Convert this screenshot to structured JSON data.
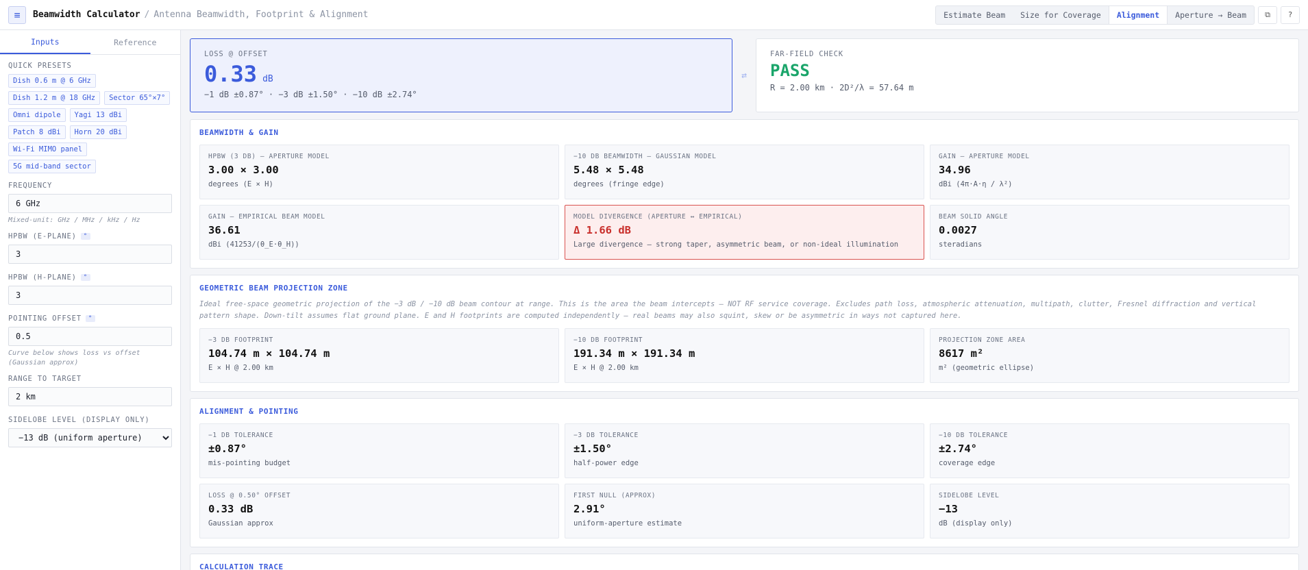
{
  "header": {
    "title": "Beamwidth Calculator",
    "separator": "/",
    "subtitle": "Antenna Beamwidth, Footprint & Alignment",
    "menu_icon": "≡",
    "tabs": [
      "Estimate Beam",
      "Size for Coverage",
      "Alignment",
      "Aperture → Beam"
    ],
    "active_tab": "Alignment",
    "copy_icon": "⧉",
    "help_icon": "?"
  },
  "sidebar": {
    "tabs": [
      "Inputs",
      "Reference"
    ],
    "presets_label": "QUICK PRESETS",
    "presets": [
      "Dish 0.6 m @ 6 GHz",
      "Dish 1.2 m @ 18 GHz",
      "Sector 65°×7°",
      "Omni dipole",
      "Yagi 13 dBi",
      "Patch 8 dBi",
      "Horn 20 dBi",
      "Wi-Fi MIMO panel",
      "5G mid-band sector"
    ],
    "frequency": {
      "label": "FREQUENCY",
      "value": "6 GHz",
      "hint": "Mixed-unit: GHz / MHz / kHz / Hz"
    },
    "hpbw_e": {
      "label": "HPBW (E-PLANE)",
      "badge": "°",
      "value": "3"
    },
    "hpbw_h": {
      "label": "HPBW (H-PLANE)",
      "badge": "°",
      "value": "3"
    },
    "pointing": {
      "label": "POINTING OFFSET",
      "badge": "°",
      "value": "0.5",
      "hint": "Curve below shows loss vs offset (Gaussian approx)"
    },
    "range": {
      "label": "RANGE TO TARGET",
      "value": "2 km"
    },
    "sidelobe": {
      "label": "SIDELOBE LEVEL (DISPLAY ONLY)",
      "value": "−13 dB (uniform aperture)"
    }
  },
  "hero": {
    "loss": {
      "label": "LOSS @ OFFSET",
      "value": "0.33",
      "unit": "dB",
      "sub": "−1 dB ±0.87° · −3 dB ±1.50° · −10 dB ±2.74°"
    },
    "swap_icon": "⇄",
    "farfield": {
      "label": "FAR-FIELD CHECK",
      "value": "PASS",
      "sub": "R = 2.00 km · 2D²/λ = 57.64 m"
    }
  },
  "beamwidth": {
    "title": "BEAMWIDTH & GAIN",
    "cards": [
      {
        "label": "HPBW (3 DB) — APERTURE MODEL",
        "value": "3.00 × 3.00",
        "sub": "degrees (E × H)"
      },
      {
        "label": "−10 DB BEAMWIDTH — GAUSSIAN MODEL",
        "value": "5.48 × 5.48",
        "sub": "degrees (fringe edge)"
      },
      {
        "label": "GAIN — APERTURE MODEL",
        "value": "34.96",
        "sub": "dBi (4π·A·η / λ²)"
      },
      {
        "label": "GAIN — EMPIRICAL BEAM MODEL",
        "value": "36.61",
        "sub": "dBi (41253/(θ_E·θ_H))"
      },
      {
        "label": "MODEL DIVERGENCE (APERTURE ↔ EMPIRICAL)",
        "value": "Δ 1.66 dB",
        "sub": "Large divergence — strong taper, asymmetric beam, or non-ideal illumination"
      },
      {
        "label": "BEAM SOLID ANGLE",
        "value": "0.0027",
        "sub": "steradians"
      }
    ]
  },
  "projection": {
    "title": "GEOMETRIC BEAM PROJECTION ZONE",
    "desc": "Ideal free-space geometric projection of the −3 dB / −10 dB beam contour at range. This is the area the beam intercepts — NOT RF service coverage. Excludes path loss, atmospheric attenuation, multipath, clutter, Fresnel diffraction and vertical pattern shape. Down-tilt assumes flat ground plane. E and H footprints are computed independently — real beams may also squint, skew or be asymmetric in ways not captured here.",
    "cards": [
      {
        "label": "−3 DB FOOTPRINT",
        "value": "104.74 m × 104.74 m",
        "sub": "E × H @ 2.00 km"
      },
      {
        "label": "−10 DB FOOTPRINT",
        "value": "191.34 m × 191.34 m",
        "sub": "E × H @ 2.00 km"
      },
      {
        "label": "PROJECTION ZONE AREA",
        "value": "8617 m²",
        "sub": "m² (geometric ellipse)"
      }
    ]
  },
  "alignment": {
    "title": "ALIGNMENT & POINTING",
    "cards": [
      {
        "label": "−1 DB TOLERANCE",
        "value": "±0.87°",
        "sub": "mis-pointing budget"
      },
      {
        "label": "−3 DB TOLERANCE",
        "value": "±1.50°",
        "sub": "half-power edge"
      },
      {
        "label": "−10 DB TOLERANCE",
        "value": "±2.74°",
        "sub": "coverage edge"
      },
      {
        "label": "LOSS @ 0.50° OFFSET",
        "value": "0.33 dB",
        "sub": "Gaussian approx"
      },
      {
        "label": "FIRST NULL (APPROX)",
        "value": "2.91°",
        "sub": "uniform-aperture estimate"
      },
      {
        "label": "SIDELOBE LEVEL",
        "value": "−13",
        "sub": "dB (display only)"
      }
    ]
  },
  "trace": {
    "title": "CALCULATION TRACE"
  },
  "colors": {
    "accent": "#3b5bdb",
    "pass": "#1aa56a",
    "danger": "#c9302c"
  }
}
